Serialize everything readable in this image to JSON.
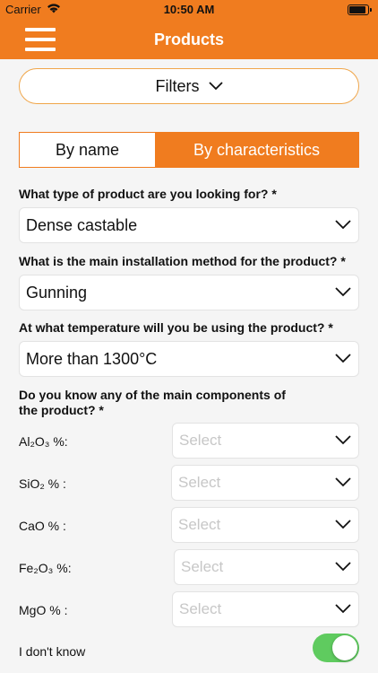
{
  "status": {
    "carrier": "Carrier",
    "time": "10:50 AM"
  },
  "nav": {
    "title": "Products"
  },
  "filters": {
    "label": "Filters"
  },
  "search_mode": {
    "by_name": "By name",
    "by_characteristics": "By characteristics",
    "selected": "by_characteristics"
  },
  "q1": {
    "label": "What type of product are you looking for? *",
    "value": "Dense castable"
  },
  "q2": {
    "label": "What is the main installation method for the product? *",
    "value": "Gunning"
  },
  "q3": {
    "label": "At what temperature will you be using the product? *",
    "value": "More than 1300°C"
  },
  "q4": {
    "line1": "Do you know any of the main components of",
    "line2": "the product? *"
  },
  "components": [
    {
      "label": "Al₂O₃ %:",
      "placeholder": "Select"
    },
    {
      "label": "SiO₂ % :",
      "placeholder": "Select"
    },
    {
      "label": "CaO % :",
      "placeholder": "Select"
    },
    {
      "label": "Fe₂O₃ %:",
      "placeholder": "Select"
    },
    {
      "label": "MgO % :",
      "placeholder": "Select"
    }
  ],
  "dont_know": {
    "label": "I don't know",
    "on": true
  },
  "colors": {
    "accent": "#f07c1f",
    "toggle_on": "#5fcb5f"
  }
}
